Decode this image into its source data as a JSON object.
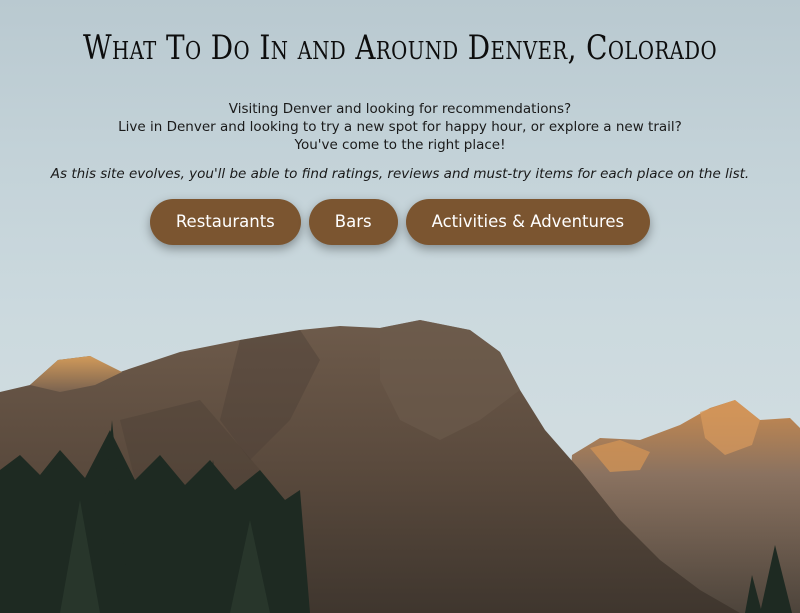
{
  "header": {
    "title": "What To Do In and Around Denver, Colorado"
  },
  "intro": {
    "lines": [
      "Visiting Denver and looking for recommendations?",
      "Live in Denver and looking to try a new spot for happy hour, or explore a new trail?",
      "You've come to the right place!"
    ],
    "note": "As this site evolves, you'll be able to find ratings, reviews and must-try items for each place on the list."
  },
  "nav": {
    "restaurants_label": "Restaurants",
    "bars_label": "Bars",
    "activities_label": "Activities & Adventures"
  },
  "colors": {
    "button_bg": "#7b5530",
    "button_text": "#ffffff",
    "sky": "#c3d2d8"
  }
}
